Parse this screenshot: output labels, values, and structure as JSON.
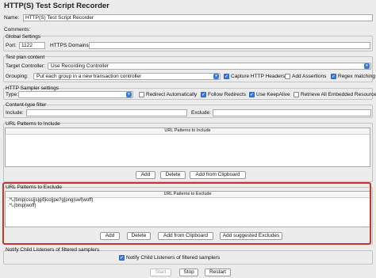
{
  "title": "HTTP(S) Test Script Recorder",
  "name": {
    "label": "Name:",
    "value": "HTTP(S) Test Script Recorder"
  },
  "comments": {
    "label": "Comments:"
  },
  "global_settings": {
    "legend": "Global Settings",
    "port_label": "Port:",
    "port_value": "1122",
    "https_label": "HTTPS Domains :",
    "https_value": ""
  },
  "test_plan": {
    "legend": "Test plan content",
    "target_label": "Target Controller:",
    "target_value": "Use Recording Controller",
    "grouping_label": "Grouping:",
    "grouping_value": "Put each group in a new transaction controller",
    "capture_label": "Capture HTTP Headers",
    "capture_checked": true,
    "assertions_label": "Add Assertions",
    "assertions_checked": false,
    "regex_label": "Regex matching",
    "regex_checked": true
  },
  "sampler": {
    "legend": "HTTP Sampler settings",
    "type_label": "Type:",
    "type_value": "",
    "redirect_auto_label": "Redirect Automatically",
    "redirect_auto_checked": false,
    "follow_label": "Follow Redirects",
    "follow_checked": true,
    "keepalive_label": "Use KeepAlive",
    "keepalive_checked": true,
    "retrieve_label": "Retrieve All Embedded Resources",
    "retrieve_checked": false
  },
  "content_type": {
    "legend": "Content-type filter",
    "include_label": "Include:",
    "exclude_label": "Exclude:"
  },
  "include_panel": {
    "legend": "URL Patterns to Include",
    "header": "URL Patterns to Include",
    "add": "Add",
    "delete": "Delete",
    "add_clipboard": "Add from Clipboard"
  },
  "exclude_panel": {
    "legend": "URL Patterns to Exclude",
    "header": "URL Patterns to Exclude",
    "rows": [
      ".*\\.(bmp|css|js|gif|ico|jpe?g|png|swf|woff)",
      ".*\\.(bmp|woff)"
    ],
    "add": "Add",
    "delete": "Delete",
    "add_clipboard": "Add from Clipboard",
    "add_suggested": "Add suggested Excludes"
  },
  "notify": {
    "legend": "Notify Child Listeners of filtered samplers",
    "label": "Notify Child Listeners of filtered samplers",
    "checked": true
  },
  "footer": {
    "start": "Start",
    "stop": "Stop",
    "restart": "Restart"
  },
  "colors": {
    "accent": "#3b7be0",
    "highlight": "#c0392b"
  }
}
